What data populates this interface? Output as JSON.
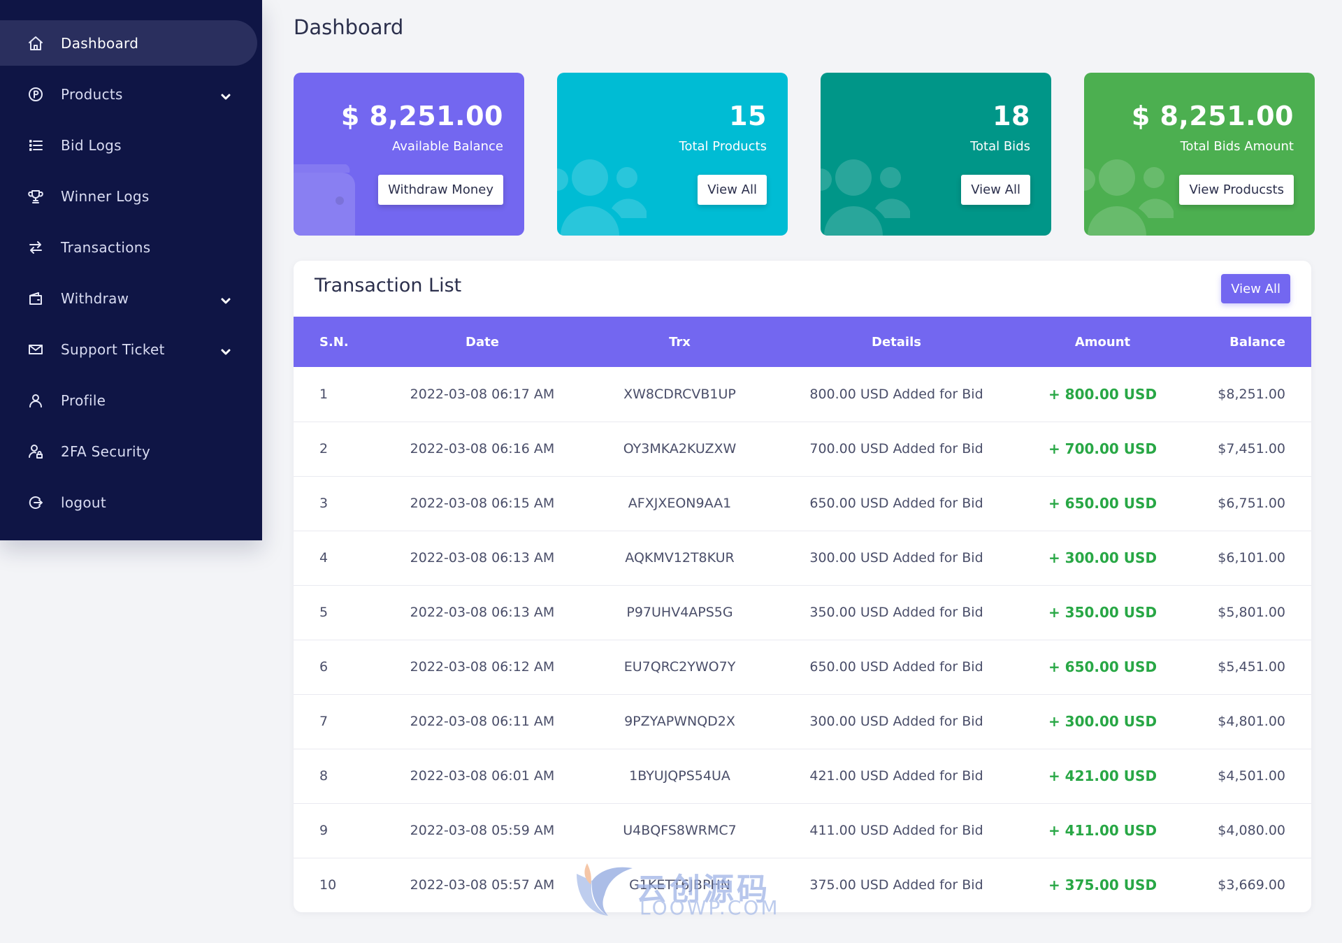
{
  "sidebar": {
    "items": [
      {
        "label": "Dashboard",
        "icon": "home-icon",
        "active": true
      },
      {
        "label": "Products",
        "icon": "product-circle-icon",
        "dropdown": true
      },
      {
        "label": "Bid Logs",
        "icon": "list-icon"
      },
      {
        "label": "Winner Logs",
        "icon": "trophy-icon"
      },
      {
        "label": "Transactions",
        "icon": "transfer-arrows-icon"
      },
      {
        "label": "Withdraw",
        "icon": "wallet-icon",
        "dropdown": true
      },
      {
        "label": "Support Ticket",
        "icon": "envelope-icon",
        "dropdown": true
      },
      {
        "label": "Profile",
        "icon": "user-icon"
      },
      {
        "label": "2FA Security",
        "icon": "user-lock-icon"
      },
      {
        "label": "logout",
        "icon": "logout-icon"
      }
    ]
  },
  "page": {
    "title": "Dashboard"
  },
  "cards": [
    {
      "value": "$ 8,251.00",
      "label": "Available Balance",
      "button": "Withdraw Money",
      "color": "#7367f0",
      "decor": "wallet"
    },
    {
      "value": "15",
      "label": "Total Products",
      "button": "View All",
      "color": "#00bcd4",
      "decor": "users"
    },
    {
      "value": "18",
      "label": "Total Bids",
      "button": "View All",
      "color": "#009688",
      "decor": "users"
    },
    {
      "value": "$ 8,251.00",
      "label": "Total Bids Amount",
      "button": "View Producsts",
      "color": "#4caf50",
      "decor": "users"
    }
  ],
  "transactions": {
    "title": "Transaction List",
    "view_all": "View All",
    "columns": [
      "S.N.",
      "Date",
      "Trx",
      "Details",
      "Amount",
      "Balance"
    ],
    "rows": [
      {
        "sn": "1",
        "date": "2022-03-08 06:17 AM",
        "trx": "XW8CDRCVB1UP",
        "details": "800.00 USD Added for Bid",
        "amount": "+ 800.00 USD",
        "balance": "$8,251.00"
      },
      {
        "sn": "2",
        "date": "2022-03-08 06:16 AM",
        "trx": "OY3MKA2KUZXW",
        "details": "700.00 USD Added for Bid",
        "amount": "+ 700.00 USD",
        "balance": "$7,451.00"
      },
      {
        "sn": "3",
        "date": "2022-03-08 06:15 AM",
        "trx": "AFXJXEON9AA1",
        "details": "650.00 USD Added for Bid",
        "amount": "+ 650.00 USD",
        "balance": "$6,751.00"
      },
      {
        "sn": "4",
        "date": "2022-03-08 06:13 AM",
        "trx": "AQKMV12T8KUR",
        "details": "300.00 USD Added for Bid",
        "amount": "+ 300.00 USD",
        "balance": "$6,101.00"
      },
      {
        "sn": "5",
        "date": "2022-03-08 06:13 AM",
        "trx": "P97UHV4APS5G",
        "details": "350.00 USD Added for Bid",
        "amount": "+ 350.00 USD",
        "balance": "$5,801.00"
      },
      {
        "sn": "6",
        "date": "2022-03-08 06:12 AM",
        "trx": "EU7QRC2YWO7Y",
        "details": "650.00 USD Added for Bid",
        "amount": "+ 650.00 USD",
        "balance": "$5,451.00"
      },
      {
        "sn": "7",
        "date": "2022-03-08 06:11 AM",
        "trx": "9PZYAPWNQD2X",
        "details": "300.00 USD Added for Bid",
        "amount": "+ 300.00 USD",
        "balance": "$4,801.00"
      },
      {
        "sn": "8",
        "date": "2022-03-08 06:01 AM",
        "trx": "1BYUJQPS54UA",
        "details": "421.00 USD Added for Bid",
        "amount": "+ 421.00 USD",
        "balance": "$4,501.00"
      },
      {
        "sn": "9",
        "date": "2022-03-08 05:59 AM",
        "trx": "U4BQFS8WRMC7",
        "details": "411.00 USD Added for Bid",
        "amount": "+ 411.00 USD",
        "balance": "$4,080.00"
      },
      {
        "sn": "10",
        "date": "2022-03-08 05:57 AM",
        "trx": "G1KETT6JBPHN",
        "details": "375.00 USD Added for Bid",
        "amount": "+ 375.00 USD",
        "balance": "$3,669.00"
      }
    ]
  },
  "watermark": {
    "text_cn": "云创源码",
    "text_en": "LOOWP.COM"
  },
  "colors": {
    "sidebar_bg": "#0f1545",
    "accent": "#7367f0",
    "positive": "#28a745"
  }
}
